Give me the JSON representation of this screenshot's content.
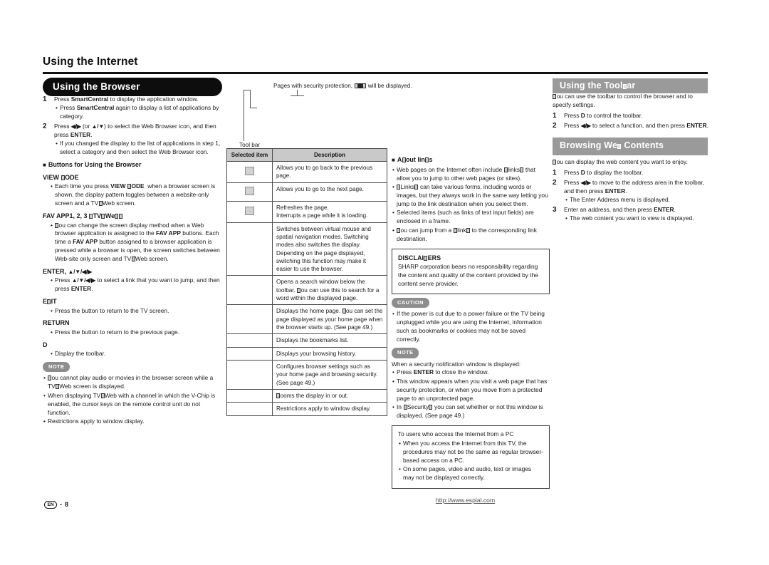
{
  "header": {
    "chapter_title": "Using the Internet"
  },
  "left_column": {
    "section_heading": "Using the Browser",
    "steps": [
      {
        "num": "1",
        "text_parts": [
          "Press ",
          "SmartCentral",
          " to display the application window."
        ],
        "subs": [
          "Press SmartCentral again to display a list of applications by category."
        ]
      },
      {
        "num": "2",
        "text_parts": [
          "Press ",
          "◀/▶",
          " (or ",
          "▲/▼",
          ") to select the Web Browser icon, and then press ",
          "ENTER",
          "."
        ],
        "subs": [
          "If you changed the display to the list of applications in step 1, select a category and then select the Web Browser icon."
        ]
      }
    ],
    "buttons_heading": "Buttons for Using the Browser",
    "button_entries": [
      {
        "name": "VIEW MODE",
        "bullets": [
          "Each time you press VIEW MODE when a browser screen is shown, the display pattern toggles between a website-only screen and a TV/Web screen."
        ]
      },
      {
        "name": "FAV APP1, 2, 3 (TV/Web)",
        "bullets": [
          "You can change the screen display method when a Web browser application is assigned to the FAV APP buttons. Each time a FAV APP button assigned to a browser application is pressed while a browser is open, the screen switches between Web-site only screen and TV/Web screen."
        ]
      },
      {
        "name": "ENTER, ▲/▼/◀/▶",
        "bullets": [
          "Press ▲/▼/◀/▶ to select a link that you want to jump, and then press ENTER."
        ]
      },
      {
        "name": "EXIT",
        "bullets": [
          "Press the button to return to the TV screen."
        ]
      },
      {
        "name": "RETURN",
        "bullets": [
          "Press the button to return to the previous page."
        ]
      },
      {
        "name": "D",
        "bullets": [
          "Display the toolbar."
        ]
      }
    ],
    "note_badge": "NOTE",
    "notes": [
      "You cannot play audio or movies in the browser screen while a TV/Web screen is displayed.",
      "When displaying TV/Web with a channel in which the V-Chip is enabled, the cursor keys on the remote control unit do not function.",
      "Restrictions apply to window display."
    ]
  },
  "middle_column": {
    "security_caption": "Pages with security protection, □□□ will be displayed.",
    "toolbar_label": "Tool bar",
    "table": {
      "headers": [
        "Selected item",
        "Description"
      ],
      "rows": [
        {
          "icon": "back-arrow-icon",
          "description": "Allows you to go back to the previous page."
        },
        {
          "icon": "forward-arrow-icon",
          "description": "Allows you to go to the next page."
        },
        {
          "icon": "refresh-icon",
          "description": "Refreshes the page.\nInterrupts a page while it is loading."
        },
        {
          "icon": "",
          "description": "Switches between virtual mouse and spatial navigation modes. Switching modes also switches the display. Depending on the page displayed, switching this function may make it easier to use the browser."
        },
        {
          "icon": "",
          "description": "Opens a search window below the toolbar. You can use this to search for a word within the displayed page."
        },
        {
          "icon": "",
          "description": "Displays the home page. You can set the page displayed as your home page when the browser starts up. (See page 49.)"
        },
        {
          "icon": "",
          "description": "Displays the bookmarks list."
        },
        {
          "icon": "",
          "description": "Displays your browsing history."
        },
        {
          "icon": "",
          "description": "Configures browser settings such as your home page and browsing security. (See page 49.)"
        },
        {
          "icon": "",
          "description": "Zooms the display in or out."
        },
        {
          "icon": "",
          "description": "Restrictions apply to window display."
        }
      ]
    }
  },
  "right_column": {
    "about_links_heading": "About links",
    "about_links_bullets": [
      "Web pages on the Internet often include “links” that allow you to jump to other web pages (or sites).",
      "“Links” can take various forms, including words or images, but they always work in the same way letting you jump to the link destination when you select them.",
      "Selected items (such as links of text input fields) are enclosed in a frame.",
      "You can jump from a “link” to the corresponding link destination."
    ],
    "disclaimer": {
      "title": "DISCLAIMERS",
      "body": "SHARP corporation bears no responsibility regarding the content and quality of the content provided by the content serve provider."
    },
    "caution_badge": "CAUTION",
    "caution_text": "If the power is cut due to a power failure or the TV being unplugged while you are using the Internet, information such as bookmarks or cookies may not be saved correctly.",
    "note_badge": "NOTE",
    "note_intro": "When a security notification window is displayed:",
    "notes": [
      "Press ENTER to close the window.",
      "This window appears when you visit a web page that has security protection, or when you move from a protected page to an unprotected page.",
      "In “Security” you can set whether or not this window is displayed. (See page 49.)"
    ],
    "pc_box": {
      "title": "To users who access the Internet from a PC",
      "bullets": [
        "When you access the Internet from this TV, the procedures may not be the same as regular browser-based access on a PC.",
        "On some pages, video and audio, text or images may not be displayed correctly."
      ]
    }
  },
  "far_column": {
    "toolbar_heading": "Using the Toolbar",
    "toolbar_intro": "You can use the toolbar to control the browser and to specify settings.",
    "toolbar_steps": [
      {
        "num": "1",
        "text": "Press D to control the toolbar.",
        "subs": []
      },
      {
        "num": "2",
        "text": "Press ◀/▶ to select a function, and then press ENTER.",
        "subs": []
      }
    ],
    "browsing_heading": "Browsing Web Contents",
    "browsing_intro": "You can display the web content you want to enjoy.",
    "browsing_steps": [
      {
        "num": "1",
        "text": "Press D to display the toolbar.",
        "subs": []
      },
      {
        "num": "2",
        "text": "Press ◀/▶ to move to the address area in the toolbar, and then press ENTER.",
        "subs": [
          "The Enter Address menu is displayed."
        ]
      },
      {
        "num": "3",
        "text": "Enter an address, and then press ENTER.",
        "subs": [
          "The web content you want to view is displayed."
        ]
      }
    ]
  },
  "footer": {
    "lang_code": "EN",
    "separator": "-",
    "page_number": "8",
    "url": "http://www.espial.com"
  }
}
